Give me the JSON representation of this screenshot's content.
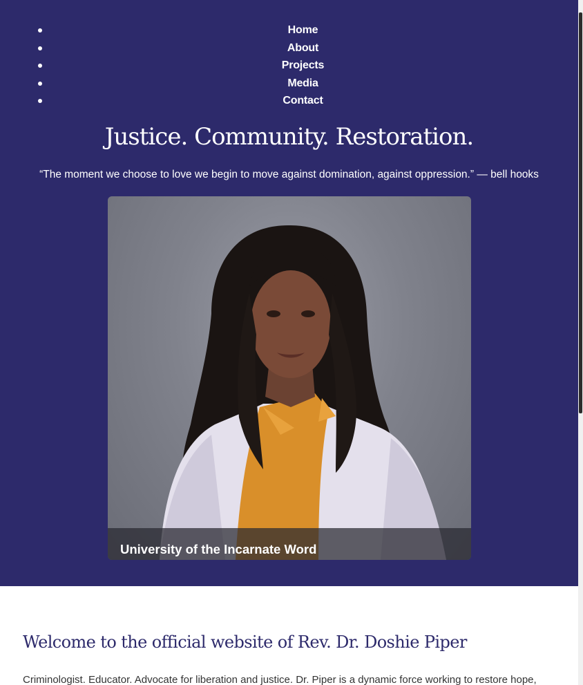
{
  "nav": {
    "items": [
      {
        "label": "Home"
      },
      {
        "label": "About"
      },
      {
        "label": "Projects"
      },
      {
        "label": "Media"
      },
      {
        "label": "Contact"
      }
    ]
  },
  "hero": {
    "headline": "Justice. Community. Restoration.",
    "quote": "“The moment we choose to love we begin to move against domination, against oppression.” — bell hooks",
    "photo_caption": "University of the Incarnate Word"
  },
  "welcome": {
    "heading": "Welcome to the official website of Rev. Dr. Doshie Piper",
    "intro": "Criminologist. Educator. Advocate for liberation and justice. Dr. Piper is a dynamic force working to restore hope,"
  },
  "colors": {
    "hero_background": "#2d2a6b",
    "heading_color": "#2d2a6b",
    "text_color": "#333333"
  }
}
